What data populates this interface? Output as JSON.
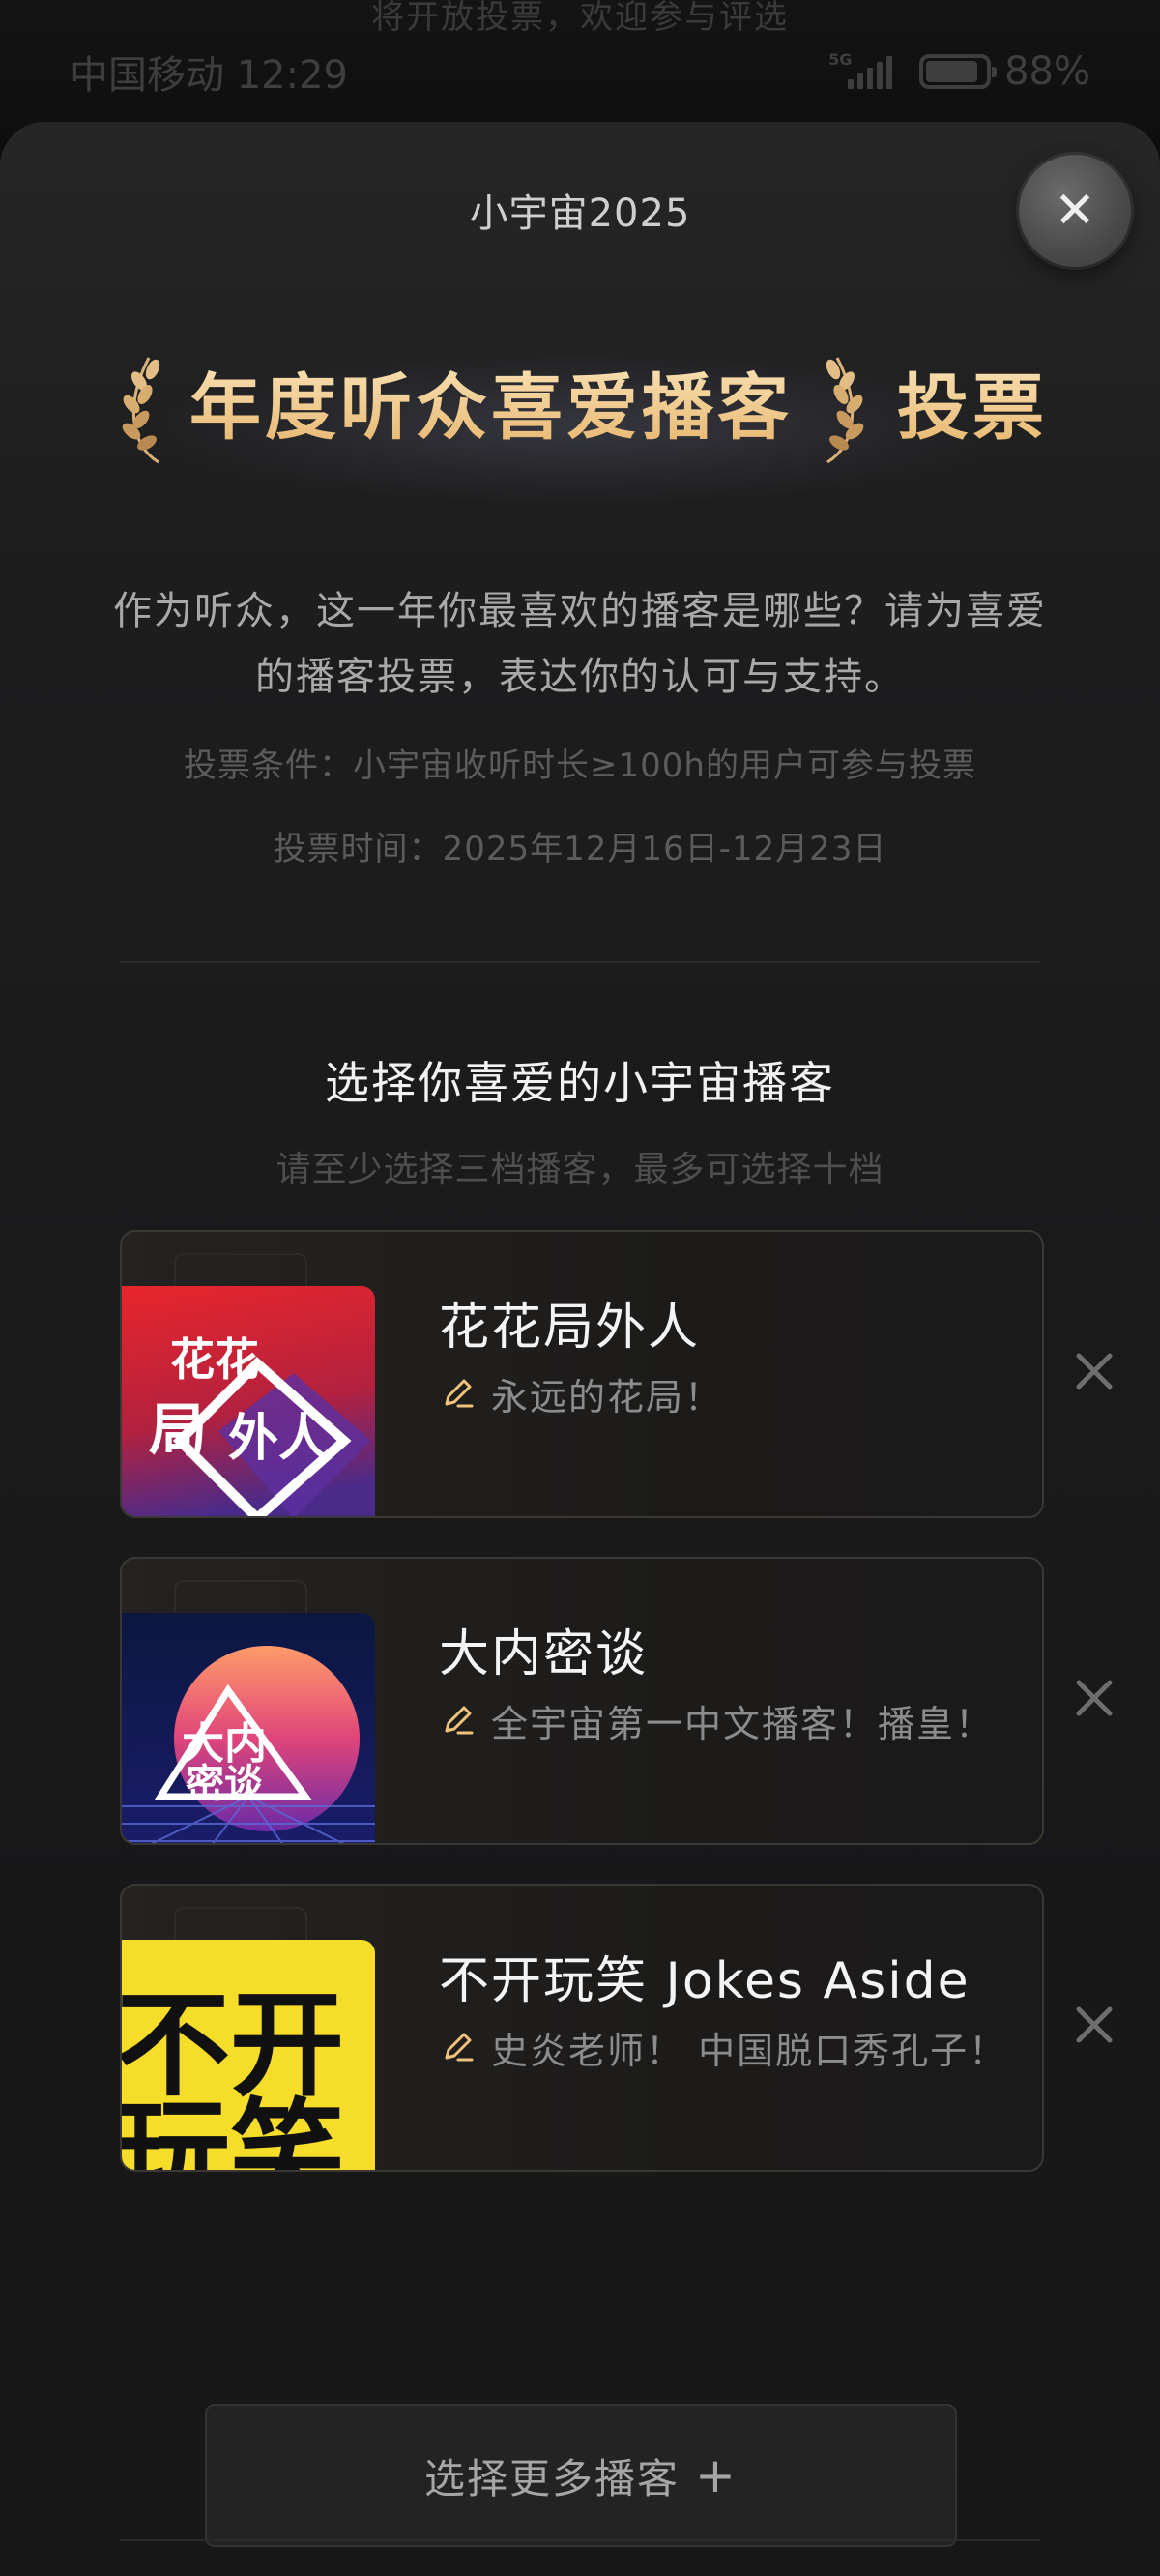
{
  "background": {
    "banner_text": "将开放投票，欢迎参与评选"
  },
  "status_bar": {
    "carrier_time": "中国移动 12:29",
    "network": "5G",
    "battery": "88%"
  },
  "sheet": {
    "title": "小宇宙2025",
    "close_icon": "close-icon",
    "hero_title": "年度听众喜爱播客",
    "hero_suffix": "投票",
    "description": "作为听众，这一年你最喜欢的播客是哪些？请为喜爱的播客投票，表达你的认可与支持。",
    "condition": "投票条件：小宇宙收听时长≥100h的用户可参与投票",
    "time": "投票时间：2025年12月16日-12月23日",
    "section_title": "选择你喜爱的小宇宙播客",
    "section_subtitle": "请至少选择三档播客，最多可选择十档",
    "podcasts": [
      {
        "name": "花花局外人",
        "quote": "永远的花局！",
        "cover": "cover-huahua"
      },
      {
        "name": "大内密谈",
        "quote": "全宇宙第一中文播客！播皇！",
        "cover": "cover-midnight-talks"
      },
      {
        "name": "不开玩笑 Jokes Aside",
        "quote": "史炎老师！ 中国脱口秀孔子！",
        "cover": "cover-jokes-aside"
      }
    ],
    "more_button": "选择更多播客",
    "more_icon": "plus-icon"
  },
  "colors": {
    "gold": "#f1cc8e",
    "sheet_bg": "#1d1d1e",
    "card_border": "#3b3833"
  }
}
